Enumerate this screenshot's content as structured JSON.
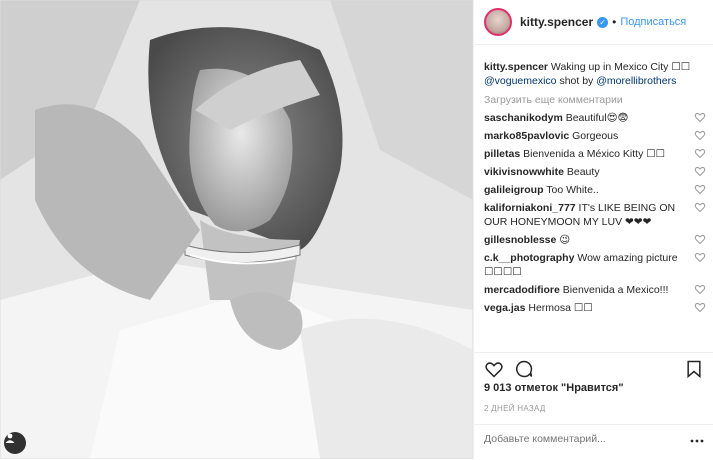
{
  "post": {
    "author": "kitty.spencer",
    "follow_label": "Подписаться",
    "dot": "•",
    "caption_text": "Waking up in Mexico City",
    "caption_mention1": "@voguemexico",
    "caption_middle": "shot by",
    "caption_mention2": "@morellibrothers",
    "load_more": "Загрузить еще комментарии",
    "comments": [
      {
        "user": "saschanikodym",
        "text": "Beautiful😍😨"
      },
      {
        "user": "marko85pavlovic",
        "text": "Gorgeous"
      },
      {
        "user": "pilletas",
        "text": "Bienvenida a México Kitty"
      },
      {
        "user": "vikivisnowwhite",
        "text": "Beauty"
      },
      {
        "user": "galileigroup",
        "text": "Too White.."
      },
      {
        "user": "kalifornia­koni_777",
        "text": "IT's LIKE BEING ON OUR HONEYMOON MY LUV ❤❤❤"
      },
      {
        "user": "gillesnoblesse",
        "text": "😉"
      },
      {
        "user": "c.k__photography",
        "text": "Wow amazing picture"
      },
      {
        "user": "mercadodifiore",
        "text": "Bienvenida a Mexico!!!"
      },
      {
        "user": "vega.jas",
        "text": "Hermosa"
      }
    ],
    "likes": "9 013 отметок \"Нравится\"",
    "time": "2 ДНЕЙ НАЗАД",
    "add_comment_placeholder": "Добавьте комментарий..."
  },
  "icons": {
    "verified": "verified-badge-icon",
    "like": "heart-icon",
    "comment": "comment-icon",
    "save": "bookmark-icon",
    "more": "more-options-icon",
    "user_tag": "user-tag-icon"
  },
  "colors": {
    "accent": "#3897f0",
    "text": "#262626",
    "muted": "#999999",
    "border": "#efefef"
  }
}
